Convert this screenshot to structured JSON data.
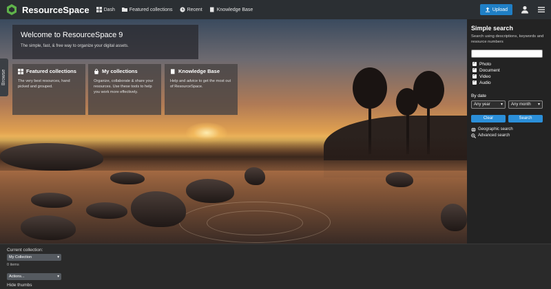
{
  "header": {
    "brand": "ResourceSpace",
    "nav": [
      {
        "label": "Dash",
        "icon": "grid-icon"
      },
      {
        "label": "Featured collections",
        "icon": "folder-icon"
      },
      {
        "label": "Recent",
        "icon": "clock-icon"
      },
      {
        "label": "Knowledge Base",
        "icon": "book-icon"
      }
    ],
    "upload_label": "Upload",
    "accent": "#1f7fc6"
  },
  "browse_tab": "Browse",
  "welcome": {
    "title": "Welcome to ResourceSpace 9",
    "subtitle": "The simple, fast, & free way to organize your digital assets."
  },
  "tiles": [
    {
      "title": "Featured collections",
      "desc": "The very best resources, hand picked and grouped.",
      "icon": "grid-icon"
    },
    {
      "title": "My collections",
      "desc": "Organize, collaborate & share your resources. Use these tools to help you work more effectively.",
      "icon": "shopping-bag-icon"
    },
    {
      "title": "Knowledge Base",
      "desc": "Help and advice to get the most out of ResourceSpace.",
      "icon": "book-icon"
    }
  ],
  "search": {
    "title": "Simple search",
    "hint": "Search using descriptions, keywords and resource numbers",
    "input_value": "",
    "types": [
      "Photo",
      "Document",
      "Video",
      "Audio"
    ],
    "bydate_label": "By date",
    "year_value": "Any year",
    "month_value": "Any month",
    "clear_label": "Clear",
    "search_label": "Search",
    "geo_label": "Geographic search",
    "advanced_label": "Advanced search",
    "button_color": "#2b8fd9"
  },
  "collection_bar": {
    "current_label": "Current collection:",
    "selected": "My Collection",
    "count": "0 items",
    "actions": "Actions...",
    "hide_thumbs": "Hide thumbs"
  }
}
